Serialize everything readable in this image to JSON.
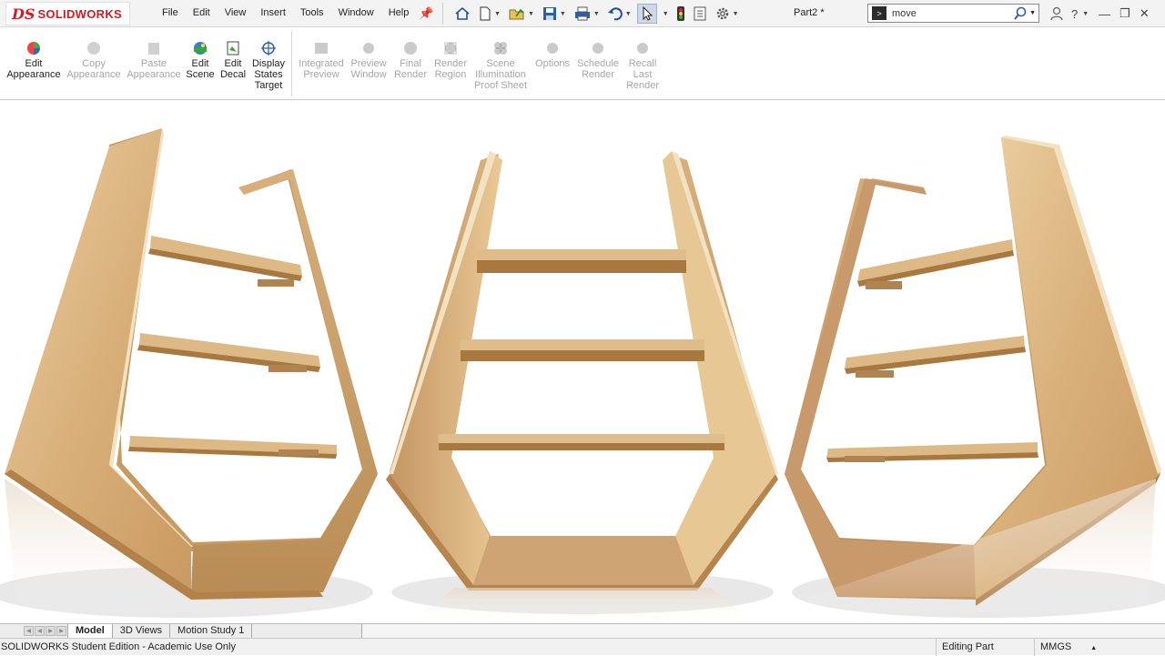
{
  "app": {
    "brand": "SOLIDWORKS",
    "logo_mark": "DS",
    "document_title": "Part2 *"
  },
  "menu": [
    "File",
    "Edit",
    "View",
    "Insert",
    "Tools",
    "Window",
    "Help"
  ],
  "search": {
    "value": "move"
  },
  "ribbon": {
    "buttons": [
      {
        "label": "Edit\nAppearance",
        "icon": "appearance-icon",
        "enabled": true
      },
      {
        "label": "Copy\nAppearance",
        "icon": "copy-appearance-icon",
        "enabled": false
      },
      {
        "label": "Paste\nAppearance",
        "icon": "paste-appearance-icon",
        "enabled": false
      },
      {
        "label": "Edit\nScene",
        "icon": "scene-icon",
        "enabled": true
      },
      {
        "label": "Edit\nDecal",
        "icon": "decal-icon",
        "enabled": true
      },
      {
        "label": "Display\nStates\nTarget",
        "icon": "display-states-icon",
        "enabled": true
      },
      {
        "label": "Integrated\nPreview",
        "icon": "integrated-preview-icon",
        "enabled": false
      },
      {
        "label": "Preview\nWindow",
        "icon": "preview-window-icon",
        "enabled": false
      },
      {
        "label": "Final\nRender",
        "icon": "final-render-icon",
        "enabled": false
      },
      {
        "label": "Render\nRegion",
        "icon": "render-region-icon",
        "enabled": false
      },
      {
        "label": "Scene\nIllumination\nProof Sheet",
        "icon": "illumination-icon",
        "enabled": false
      },
      {
        "label": "Options",
        "icon": "options-icon",
        "enabled": false
      },
      {
        "label": "Schedule\nRender",
        "icon": "schedule-render-icon",
        "enabled": false
      },
      {
        "label": "Recall\nLast\nRender",
        "icon": "recall-render-icon",
        "enabled": false
      }
    ]
  },
  "tabs": [
    "Model",
    "3D Views",
    "Motion Study 1"
  ],
  "status": {
    "edition": "SOLIDWORKS Student Edition - Academic Use Only",
    "mode": "Editing Part",
    "units": "MMGS"
  },
  "colors": {
    "brand_red": "#d81920",
    "wood_light": "#e2c08d",
    "wood_dark": "#b98c55",
    "accent_blue": "#2a6ad8"
  }
}
